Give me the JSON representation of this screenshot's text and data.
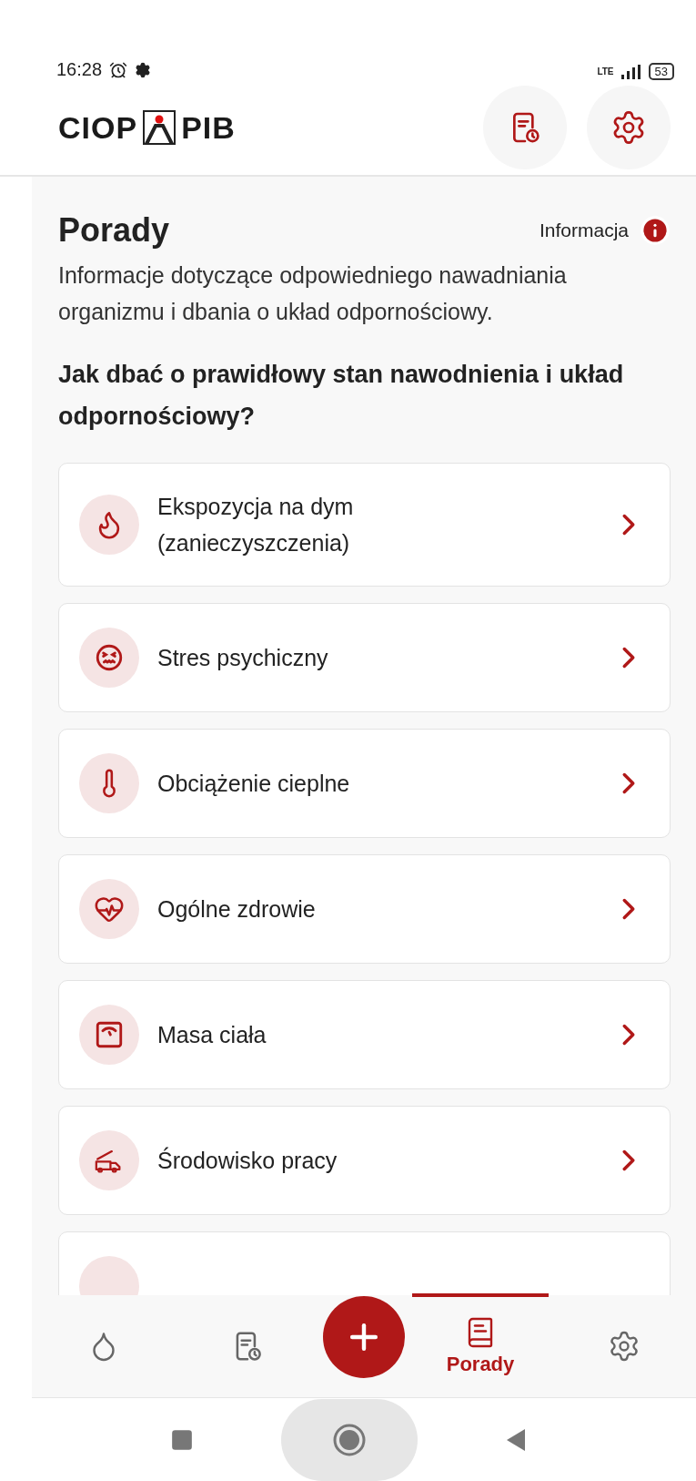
{
  "status_bar": {
    "time": "16:28",
    "network": "LTE",
    "battery": "53"
  },
  "header": {
    "logo_left": "CIOP",
    "logo_right": "PIB"
  },
  "page": {
    "title": "Porady",
    "info_link": "Informacja",
    "description": "Informacje dotyczące odpowiedniego nawadniania organizmu i dbania o układ odpornościowy.",
    "heading": "Jak dbać o prawidłowy stan nawodnienia i układ odpornościowy?"
  },
  "topics": [
    {
      "kind": "topic",
      "title": "Ekspozycja na dym (zanieczyszczenia)"
    },
    {
      "kind": "topic",
      "title": "Stres psychiczny"
    },
    {
      "kind": "topic",
      "title": "Obciążenie cieplne"
    },
    {
      "kind": "topic",
      "title": "Ogólne zdrowie"
    },
    {
      "kind": "topic",
      "title": "Masa ciała"
    },
    {
      "kind": "topic",
      "title": "Środowisko pracy"
    },
    {
      "kind": "partial"
    }
  ],
  "bottom_nav": [
    {
      "kind": "tab",
      "selected": false
    },
    {
      "kind": "tab",
      "selected": false
    },
    {
      "kind": "fab"
    },
    {
      "kind": "tab",
      "selected": true,
      "label": "Porady"
    },
    {
      "kind": "tab",
      "selected": false
    }
  ]
}
